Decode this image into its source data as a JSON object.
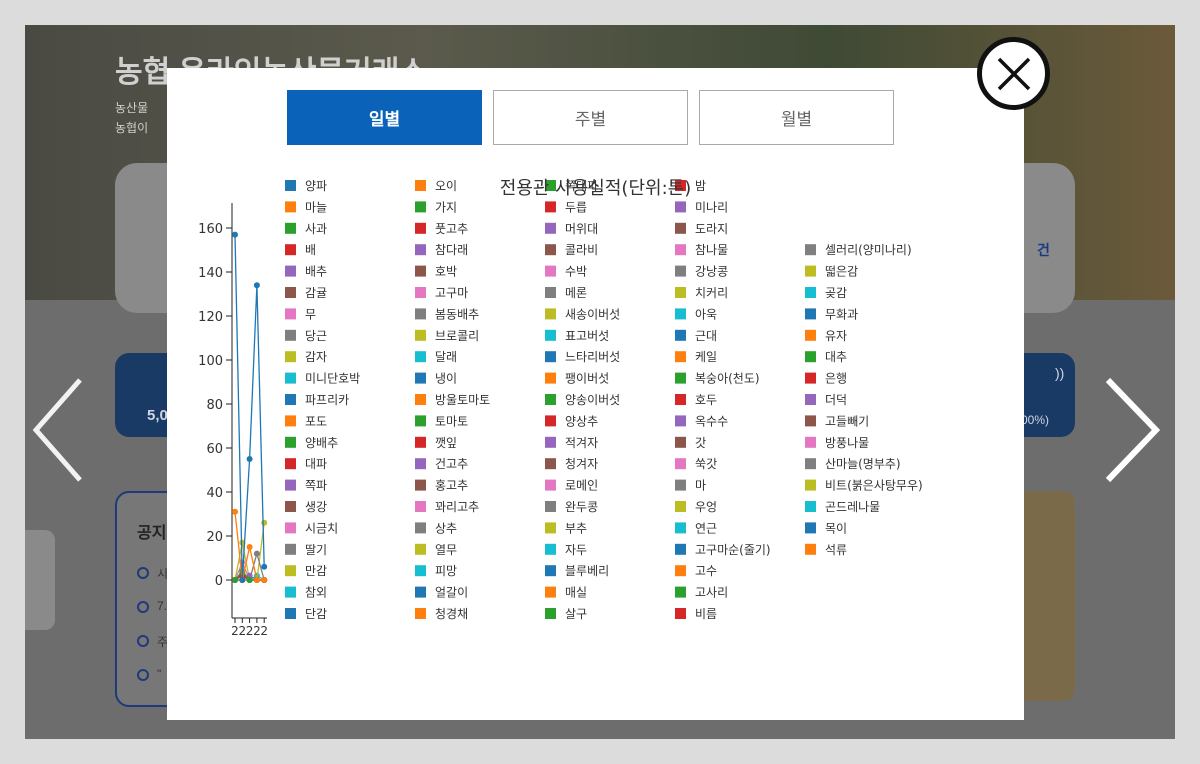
{
  "background": {
    "hero_title": "농협 온라인농산물거래소",
    "hero_line1": "농산물",
    "hero_line2": "농협이",
    "card_right_text": "건",
    "blue_left_text": "5,0",
    "blue_right_text": "00%)",
    "blue_right_top": "))",
    "notice_title": "공지",
    "notice_items": [
      "시",
      "7.",
      "주",
      "\"",
      ""
    ]
  },
  "tabs": [
    {
      "label": "일별",
      "active": true
    },
    {
      "label": "주별",
      "active": false
    },
    {
      "label": "월별",
      "active": false
    }
  ],
  "colors": {
    "palette": [
      "#1f77b4",
      "#ff7f0e",
      "#2ca02c",
      "#d62728",
      "#9467bd",
      "#8c564b",
      "#e377c2",
      "#7f7f7f",
      "#bcbd22",
      "#17becf"
    ],
    "active_tab": "#0a63b8"
  },
  "icons": {
    "close": "close-x-icon",
    "prev": "chevron-left-icon",
    "next": "chevron-right-icon"
  },
  "chart_data": {
    "type": "line",
    "title": "전용관 사용실적(단위:톤)",
    "ylim": [
      -10,
      170
    ],
    "yticks": [
      0,
      20,
      40,
      60,
      80,
      100,
      120,
      140,
      160
    ],
    "x": [
      "2",
      "2",
      "2",
      "2",
      "2"
    ],
    "legend_placement": "right",
    "legend_columns": [
      [
        "양파",
        "마늘",
        "사과",
        "배",
        "배추",
        "감귤",
        "무",
        "당근",
        "감자",
        "미니단호박",
        "파프리카",
        "포도",
        "양배추",
        "대파",
        "쪽파",
        "생강",
        "시금치",
        "딸기",
        "만감",
        "참외",
        "단감"
      ],
      [
        "오이",
        "가지",
        "풋고추",
        "참다래",
        "호박",
        "고구마",
        "봄동배추",
        "브로콜리",
        "달래",
        "냉이",
        "방울토마토",
        "토마토",
        "깻잎",
        "건고추",
        "홍고추",
        "꽈리고추",
        "상추",
        "열무",
        "피망",
        "얼갈이",
        "청경채"
      ],
      [
        "쪽대파",
        "두릅",
        "머위대",
        "콜라비",
        "수박",
        "메론",
        "새송이버섯",
        "표고버섯",
        "느타리버섯",
        "팽이버섯",
        "양송이버섯",
        "양상추",
        "적겨자",
        "청겨자",
        "로메인",
        "완두콩",
        "부추",
        "자두",
        "블루베리",
        "매실",
        "살구"
      ],
      [
        "밤",
        "미나리",
        "도라지",
        "참나물",
        "강낭콩",
        "치커리",
        "아욱",
        "근대",
        "케일",
        "복숭아(천도)",
        "호두",
        "옥수수",
        "갓",
        "쑥갓",
        "마",
        "우엉",
        "연근",
        "고구마순(줄기)",
        "고수",
        "고사리",
        "비름"
      ],
      [
        "",
        "",
        "",
        "셀러리(양미나리)",
        "떫은감",
        "곶감",
        "무화과",
        "유자",
        "대추",
        "은행",
        "더덕",
        "고들빼기",
        "방풍나물",
        "산마늘(명부추)",
        "비트(붉은사탕무우)",
        "곤드레나물",
        "목이",
        "석류",
        "",
        "",
        ""
      ]
    ],
    "series": [
      {
        "name": "양파",
        "values": [
          157,
          0,
          55,
          134,
          6
        ]
      },
      {
        "name": "마늘",
        "values": [
          31,
          0,
          15,
          0,
          0
        ]
      },
      {
        "name": "사과",
        "values": [
          0,
          4,
          0,
          0,
          0
        ]
      },
      {
        "name": "배",
        "values": [
          0,
          2,
          0,
          0,
          0
        ]
      },
      {
        "name": "배추",
        "values": [
          0,
          0,
          2,
          0,
          0
        ]
      },
      {
        "name": "감귤",
        "values": [
          0,
          3,
          0,
          0,
          0
        ]
      },
      {
        "name": "당근",
        "values": [
          0,
          8,
          0,
          0,
          0
        ]
      },
      {
        "name": "오이",
        "values": [
          0,
          0,
          0,
          12,
          0
        ]
      },
      {
        "name": "감자",
        "values": [
          0,
          17,
          0,
          0,
          26
        ]
      },
      {
        "name": "열무",
        "values": [
          0,
          0,
          0,
          2,
          0
        ]
      }
    ]
  }
}
